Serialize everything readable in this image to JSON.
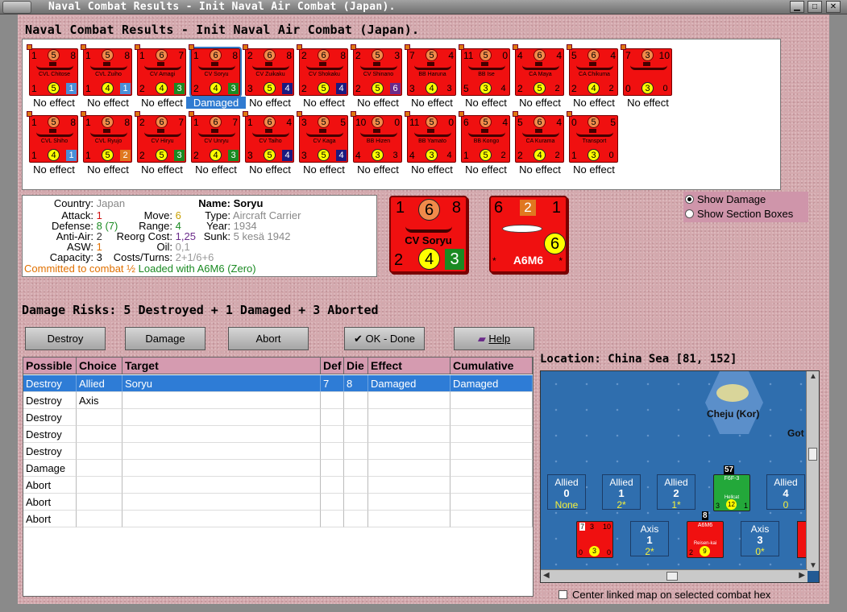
{
  "window": {
    "title": "Naval Combat Results - Init Naval Air Combat (Japan)."
  },
  "heading": "Naval Combat Results - Init Naval Air Combat (Japan).",
  "units": [
    {
      "tl": "1",
      "tc": "5",
      "tr": "8",
      "name": "CVL Chitose",
      "bl": "1",
      "bc": "5",
      "br": "1",
      "brc": "#4a8fd8",
      "effect": "No effect"
    },
    {
      "tl": "1",
      "tc": "5",
      "tr": "8",
      "name": "CVL Zuiho",
      "bl": "1",
      "bc": "4",
      "br": "1",
      "brc": "#4a8fd8",
      "effect": "No effect"
    },
    {
      "tl": "1",
      "tc": "6",
      "tr": "7",
      "name": "CV Amagi",
      "bl": "2",
      "bc": "4",
      "br": "3",
      "brc": "#1a8a22",
      "effect": "No effect"
    },
    {
      "tl": "1",
      "tc": "6",
      "tr": "8",
      "name": "CV Soryu",
      "bl": "2",
      "bc": "4",
      "br": "3",
      "brc": "#1a8a22",
      "effect": "Damaged",
      "selected": true
    },
    {
      "tl": "2",
      "tc": "6",
      "tr": "8",
      "name": "CV Zuikaku",
      "bl": "3",
      "bc": "5",
      "br": "4",
      "brc": "#1a1a80",
      "effect": "No effect"
    },
    {
      "tl": "2",
      "tc": "6",
      "tr": "8",
      "name": "CV Shokaku",
      "bl": "2",
      "bc": "5",
      "br": "4",
      "brc": "#1a1a80",
      "effect": "No effect"
    },
    {
      "tl": "2",
      "tc": "5",
      "tr": "3",
      "name": "CV Shinano",
      "bl": "2",
      "bc": "5",
      "br": "6",
      "brc": "#6a2a8a",
      "effect": "No effect"
    },
    {
      "tl": "7",
      "tc": "5",
      "tr": "4",
      "name": "BB Haruna",
      "bl": "3",
      "bc": "4",
      "br": "3",
      "brc": "",
      "effect": "No effect"
    },
    {
      "tl": "11",
      "tc": "5",
      "tr": "0",
      "name": "BB Ise",
      "bl": "5",
      "bc": "3",
      "br": "4",
      "brc": "",
      "effect": "No effect"
    },
    {
      "tl": "4",
      "tc": "6",
      "tr": "4",
      "name": "CA Maya",
      "bl": "2",
      "bc": "5",
      "br": "2",
      "brc": "",
      "effect": "No effect"
    },
    {
      "tl": "5",
      "tc": "6",
      "tr": "4",
      "name": "CA Chikuma",
      "bl": "2",
      "bc": "4",
      "br": "2",
      "brc": "",
      "effect": "No effect"
    },
    {
      "tl": "7",
      "tc": "3",
      "tr": "10",
      "name": "",
      "bl": "0",
      "bc": "3",
      "br": "0",
      "brc": "",
      "effect": "No effect"
    },
    {
      "tl": "1",
      "tc": "5",
      "tr": "8",
      "name": "CVL Shiho",
      "bl": "1",
      "bc": "4",
      "br": "1",
      "brc": "#4a8fd8",
      "effect": "No effect"
    },
    {
      "tl": "1",
      "tc": "5",
      "tr": "8",
      "name": "CVL Ryujo",
      "bl": "1",
      "bc": "5",
      "br": "2",
      "brc": "#e07820",
      "effect": "No effect"
    },
    {
      "tl": "2",
      "tc": "6",
      "tr": "7",
      "name": "CV Hiryu",
      "bl": "2",
      "bc": "5",
      "br": "3",
      "brc": "#1a8a22",
      "effect": "No effect"
    },
    {
      "tl": "1",
      "tc": "6",
      "tr": "7",
      "name": "CV Unryu",
      "bl": "2",
      "bc": "4",
      "br": "3",
      "brc": "#1a8a22",
      "effect": "No effect"
    },
    {
      "tl": "1",
      "tc": "6",
      "tr": "4",
      "name": "CV Taiho",
      "bl": "3",
      "bc": "5",
      "br": "4",
      "brc": "#1a1a80",
      "effect": "No effect"
    },
    {
      "tl": "3",
      "tc": "5",
      "tr": "5",
      "name": "CV Kaga",
      "bl": "3",
      "bc": "5",
      "br": "4",
      "brc": "#1a1a80",
      "effect": "No effect"
    },
    {
      "tl": "10",
      "tc": "5",
      "tr": "0",
      "name": "BB Hizen",
      "bl": "4",
      "bc": "3",
      "br": "3",
      "brc": "",
      "effect": "No effect"
    },
    {
      "tl": "11",
      "tc": "5",
      "tr": "0",
      "name": "BB Yamato",
      "bl": "4",
      "bc": "3",
      "br": "4",
      "brc": "",
      "effect": "No effect"
    },
    {
      "tl": "6",
      "tc": "5",
      "tr": "4",
      "name": "BB Kongo",
      "bl": "1",
      "bc": "5",
      "br": "2",
      "brc": "",
      "effect": "No effect"
    },
    {
      "tl": "5",
      "tc": "6",
      "tr": "4",
      "name": "CA Kurama",
      "bl": "2",
      "bc": "4",
      "br": "2",
      "brc": "",
      "effect": "No effect"
    },
    {
      "tl": "0",
      "tc": "5",
      "tr": "5",
      "name": "Transport",
      "bl": "1",
      "bc": "3",
      "br": "0",
      "brc": "",
      "effect": "No effect"
    }
  ],
  "info": {
    "country_label": "Country:",
    "country": "Japan",
    "attack_label": "Attack:",
    "attack": "1",
    "defense_label": "Defense:",
    "defense": "8 (7)",
    "antiair_label": "Anti-Air:",
    "antiair": "2",
    "asw_label": "ASW:",
    "asw": "1",
    "capacity_label": "Capacity:",
    "capacity": "3",
    "move_label": "Move:",
    "move": "6",
    "range_label": "Range:",
    "range": "4",
    "reorg_label": "Reorg Cost:",
    "reorg": "1,25",
    "oil_label": "Oil:",
    "oil": "0,1",
    "costs_label": "Costs/Turns:",
    "costs": "2+1/6+6",
    "name_label": "Name:",
    "name": "Soryu",
    "type_label": "Type:",
    "type": "Aircraft Carrier",
    "year_label": "Year:",
    "year": "1934",
    "sunk_label": "Sunk:",
    "sunk": "5 kesä 1942",
    "committed": "Committed to combat ½",
    "loaded": "Loaded with A6M6 (Zero)"
  },
  "big_ship": {
    "tl": "1",
    "tc": "6",
    "tr": "8",
    "name": "CV Soryu",
    "bl": "2",
    "bc": "4",
    "br": "3"
  },
  "big_plane": {
    "tl": "6",
    "tc": "2",
    "tr": "1",
    "mid": "6",
    "name": "A6M6",
    "star_l": "*",
    "star_r": "*"
  },
  "options": {
    "show_damage": "Show Damage",
    "show_section": "Show Section Boxes"
  },
  "risks": "Damage Risks: 5 Destroyed + 1 Damaged + 3 Aborted",
  "buttons": {
    "destroy": "Destroy",
    "damage": "Damage",
    "abort": "Abort",
    "ok": "OK - Done",
    "help": "Help"
  },
  "table": {
    "headers": [
      "Possible",
      "Choice",
      "Target",
      "Def",
      "Die",
      "Effect",
      "Cumulative"
    ],
    "rows": [
      [
        "Destroy",
        "Allied",
        "Soryu",
        "7",
        "8",
        "Damaged",
        "Damaged"
      ],
      [
        "Destroy",
        "Axis",
        "",
        "",
        "",
        "",
        ""
      ],
      [
        "Destroy",
        "",
        "",
        "",
        "",
        "",
        ""
      ],
      [
        "Destroy",
        "",
        "",
        "",
        "",
        "",
        ""
      ],
      [
        "Destroy",
        "",
        "",
        "",
        "",
        "",
        ""
      ],
      [
        "Damage",
        "",
        "",
        "",
        "",
        "",
        ""
      ],
      [
        "Abort",
        "",
        "",
        "",
        "",
        "",
        ""
      ],
      [
        "Abort",
        "",
        "",
        "",
        "",
        "",
        ""
      ],
      [
        "Abort",
        "",
        "",
        "",
        "",
        "",
        ""
      ]
    ]
  },
  "location": "Location:  China Sea [81, 152]",
  "map": {
    "island": "Cheju (Kor)",
    "got": "Got",
    "allied_slots": [
      {
        "label": "Allied",
        "num": "0",
        "sub": "None"
      },
      {
        "label": "Allied",
        "num": "1",
        "sub": "2*"
      },
      {
        "label": "Allied",
        "num": "2",
        "sub": "1*"
      },
      {
        "label": "Allied",
        "num": "4",
        "sub": "0"
      }
    ],
    "axis_slots": [
      {
        "label": "Axis",
        "num": "1",
        "sub": "2*"
      },
      {
        "label": "Axis",
        "num": "3",
        "sub": "0*"
      }
    ],
    "green_counter": {
      "top": "57",
      "name": "F6F-3",
      "sub": "Hellcat",
      "bl": "3",
      "bc": "12",
      "br": "1"
    },
    "red_counter": {
      "top": "8",
      "name": "A6M6",
      "sub": "Reisen-kai",
      "bl": "2",
      "bc": "9"
    },
    "small_counter": {
      "tl": "7",
      "tc": "3",
      "tr": "10",
      "bl": "0",
      "bc": "3",
      "br": "0"
    }
  },
  "checkbox": "Center linked map on selected combat hex",
  "colors": {
    "counter_red": "#f01010",
    "selection": "#2e7cd6",
    "header_pink": "#d59bb0",
    "panel_pink": "#d4a9ae"
  }
}
